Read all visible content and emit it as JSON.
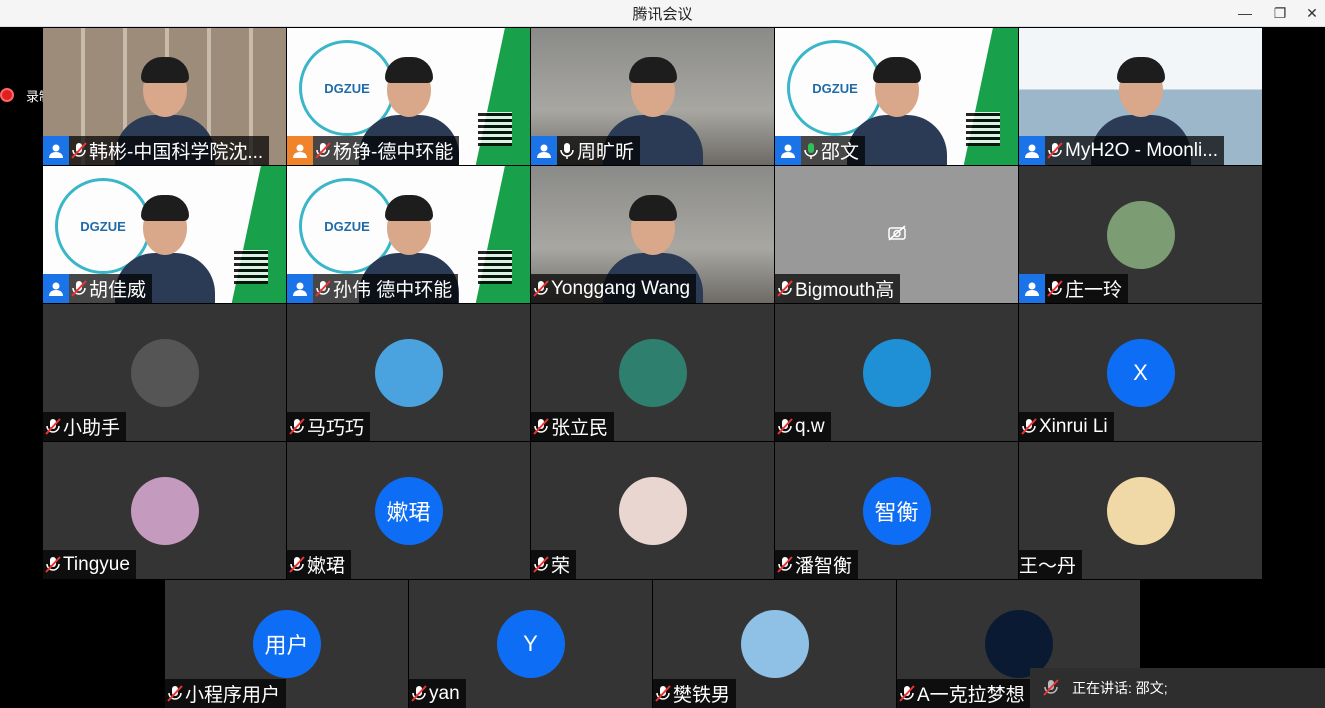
{
  "window": {
    "title": "腾讯会议"
  },
  "recording": {
    "label": "录制中"
  },
  "tiles": [
    {
      "name": "韩彬-中国科学院沈...",
      "bg": "shelf",
      "type": "video",
      "badge": "blue",
      "mic": "muted"
    },
    {
      "name": "杨铮-德中环能",
      "bg": "poster",
      "type": "video",
      "badge": "orange",
      "mic": "muted"
    },
    {
      "name": "周旷昕",
      "bg": "room",
      "type": "video",
      "badge": "blue",
      "mic": "on"
    },
    {
      "name": "邵文",
      "bg": "poster",
      "type": "video",
      "badge": "blue",
      "mic": "speaking",
      "active": true
    },
    {
      "name": "MyH2O - Moonli...",
      "bg": "water",
      "type": "video",
      "badge": "blue",
      "mic": "muted"
    },
    {
      "name": "胡佳威",
      "bg": "poster",
      "type": "video",
      "badge": "blue",
      "mic": "muted"
    },
    {
      "name": "孙伟 德中环能",
      "bg": "poster",
      "type": "video",
      "badge": "blue",
      "mic": "muted"
    },
    {
      "name": "Yonggang Wang",
      "bg": "room",
      "type": "video",
      "badge": "",
      "mic": "muted"
    },
    {
      "name": "Bigmouth高",
      "bg": "",
      "type": "camoff",
      "badge": "",
      "mic": "muted"
    },
    {
      "name": "庄一玲",
      "bg": "",
      "type": "avatar-photo",
      "avatar_color": "#7c9c73",
      "badge": "blue",
      "mic": "muted"
    },
    {
      "name": "小助手",
      "type": "avatar-photo",
      "avatar_color": "#555555",
      "badge": "",
      "mic": "muted"
    },
    {
      "name": "马巧巧",
      "type": "avatar-photo",
      "avatar_color": "#4aa3df",
      "badge": "",
      "mic": "muted"
    },
    {
      "name": "张立民",
      "type": "avatar-photo",
      "avatar_color": "#2f7f6f",
      "badge": "",
      "mic": "muted"
    },
    {
      "name": "q.w",
      "type": "avatar-photo",
      "avatar_color": "#1f8fd6",
      "badge": "",
      "mic": "muted"
    },
    {
      "name": "Xinrui Li",
      "type": "avatar-text",
      "avatar_text": "X",
      "badge": "",
      "mic": "muted"
    },
    {
      "name": "Tingyue",
      "type": "avatar-photo",
      "avatar_color": "#c59abf",
      "badge": "",
      "mic": "muted"
    },
    {
      "name": "嫰珺",
      "type": "avatar-text",
      "avatar_text": "嫰珺",
      "badge": "",
      "mic": "muted"
    },
    {
      "name": "荣",
      "type": "avatar-photo",
      "avatar_color": "#e9d6d0",
      "badge": "",
      "mic": "muted"
    },
    {
      "name": "潘智衡",
      "type": "avatar-text",
      "avatar_text": "智衡",
      "badge": "",
      "mic": "muted"
    },
    {
      "name": "王～丹",
      "type": "avatar-photo",
      "avatar_color": "#f0d9a6",
      "badge": "",
      "mic": "none"
    },
    {
      "name": "小程序用户",
      "type": "avatar-text",
      "avatar_text": "用户",
      "badge": "",
      "mic": "muted"
    },
    {
      "name": "yan",
      "type": "avatar-text",
      "avatar_text": "Y",
      "badge": "",
      "mic": "muted"
    },
    {
      "name": "樊铁男",
      "type": "avatar-photo",
      "avatar_color": "#8fc1e6",
      "badge": "",
      "mic": "muted"
    },
    {
      "name": "A一克拉梦想",
      "type": "avatar-photo",
      "avatar_color": "#0b1a33",
      "badge": "",
      "mic": "muted"
    }
  ],
  "speaking_bar": {
    "text": "正在讲话: 邵文;"
  },
  "colors": {
    "accent_blue": "#0d6ef5",
    "active_green": "#2fc25b",
    "record_red": "#e02020"
  }
}
